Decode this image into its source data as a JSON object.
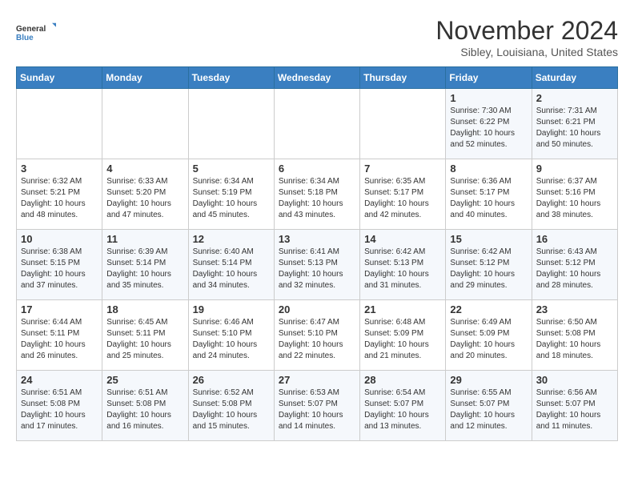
{
  "logo": {
    "line1": "General",
    "line2": "Blue"
  },
  "title": "November 2024",
  "subtitle": "Sibley, Louisiana, United States",
  "days_of_week": [
    "Sunday",
    "Monday",
    "Tuesday",
    "Wednesday",
    "Thursday",
    "Friday",
    "Saturday"
  ],
  "weeks": [
    [
      {
        "day": "",
        "info": ""
      },
      {
        "day": "",
        "info": ""
      },
      {
        "day": "",
        "info": ""
      },
      {
        "day": "",
        "info": ""
      },
      {
        "day": "",
        "info": ""
      },
      {
        "day": "1",
        "info": "Sunrise: 7:30 AM\nSunset: 6:22 PM\nDaylight: 10 hours\nand 52 minutes."
      },
      {
        "day": "2",
        "info": "Sunrise: 7:31 AM\nSunset: 6:21 PM\nDaylight: 10 hours\nand 50 minutes."
      }
    ],
    [
      {
        "day": "3",
        "info": "Sunrise: 6:32 AM\nSunset: 5:21 PM\nDaylight: 10 hours\nand 48 minutes."
      },
      {
        "day": "4",
        "info": "Sunrise: 6:33 AM\nSunset: 5:20 PM\nDaylight: 10 hours\nand 47 minutes."
      },
      {
        "day": "5",
        "info": "Sunrise: 6:34 AM\nSunset: 5:19 PM\nDaylight: 10 hours\nand 45 minutes."
      },
      {
        "day": "6",
        "info": "Sunrise: 6:34 AM\nSunset: 5:18 PM\nDaylight: 10 hours\nand 43 minutes."
      },
      {
        "day": "7",
        "info": "Sunrise: 6:35 AM\nSunset: 5:17 PM\nDaylight: 10 hours\nand 42 minutes."
      },
      {
        "day": "8",
        "info": "Sunrise: 6:36 AM\nSunset: 5:17 PM\nDaylight: 10 hours\nand 40 minutes."
      },
      {
        "day": "9",
        "info": "Sunrise: 6:37 AM\nSunset: 5:16 PM\nDaylight: 10 hours\nand 38 minutes."
      }
    ],
    [
      {
        "day": "10",
        "info": "Sunrise: 6:38 AM\nSunset: 5:15 PM\nDaylight: 10 hours\nand 37 minutes."
      },
      {
        "day": "11",
        "info": "Sunrise: 6:39 AM\nSunset: 5:14 PM\nDaylight: 10 hours\nand 35 minutes."
      },
      {
        "day": "12",
        "info": "Sunrise: 6:40 AM\nSunset: 5:14 PM\nDaylight: 10 hours\nand 34 minutes."
      },
      {
        "day": "13",
        "info": "Sunrise: 6:41 AM\nSunset: 5:13 PM\nDaylight: 10 hours\nand 32 minutes."
      },
      {
        "day": "14",
        "info": "Sunrise: 6:42 AM\nSunset: 5:13 PM\nDaylight: 10 hours\nand 31 minutes."
      },
      {
        "day": "15",
        "info": "Sunrise: 6:42 AM\nSunset: 5:12 PM\nDaylight: 10 hours\nand 29 minutes."
      },
      {
        "day": "16",
        "info": "Sunrise: 6:43 AM\nSunset: 5:12 PM\nDaylight: 10 hours\nand 28 minutes."
      }
    ],
    [
      {
        "day": "17",
        "info": "Sunrise: 6:44 AM\nSunset: 5:11 PM\nDaylight: 10 hours\nand 26 minutes."
      },
      {
        "day": "18",
        "info": "Sunrise: 6:45 AM\nSunset: 5:11 PM\nDaylight: 10 hours\nand 25 minutes."
      },
      {
        "day": "19",
        "info": "Sunrise: 6:46 AM\nSunset: 5:10 PM\nDaylight: 10 hours\nand 24 minutes."
      },
      {
        "day": "20",
        "info": "Sunrise: 6:47 AM\nSunset: 5:10 PM\nDaylight: 10 hours\nand 22 minutes."
      },
      {
        "day": "21",
        "info": "Sunrise: 6:48 AM\nSunset: 5:09 PM\nDaylight: 10 hours\nand 21 minutes."
      },
      {
        "day": "22",
        "info": "Sunrise: 6:49 AM\nSunset: 5:09 PM\nDaylight: 10 hours\nand 20 minutes."
      },
      {
        "day": "23",
        "info": "Sunrise: 6:50 AM\nSunset: 5:08 PM\nDaylight: 10 hours\nand 18 minutes."
      }
    ],
    [
      {
        "day": "24",
        "info": "Sunrise: 6:51 AM\nSunset: 5:08 PM\nDaylight: 10 hours\nand 17 minutes."
      },
      {
        "day": "25",
        "info": "Sunrise: 6:51 AM\nSunset: 5:08 PM\nDaylight: 10 hours\nand 16 minutes."
      },
      {
        "day": "26",
        "info": "Sunrise: 6:52 AM\nSunset: 5:08 PM\nDaylight: 10 hours\nand 15 minutes."
      },
      {
        "day": "27",
        "info": "Sunrise: 6:53 AM\nSunset: 5:07 PM\nDaylight: 10 hours\nand 14 minutes."
      },
      {
        "day": "28",
        "info": "Sunrise: 6:54 AM\nSunset: 5:07 PM\nDaylight: 10 hours\nand 13 minutes."
      },
      {
        "day": "29",
        "info": "Sunrise: 6:55 AM\nSunset: 5:07 PM\nDaylight: 10 hours\nand 12 minutes."
      },
      {
        "day": "30",
        "info": "Sunrise: 6:56 AM\nSunset: 5:07 PM\nDaylight: 10 hours\nand 11 minutes."
      }
    ]
  ]
}
